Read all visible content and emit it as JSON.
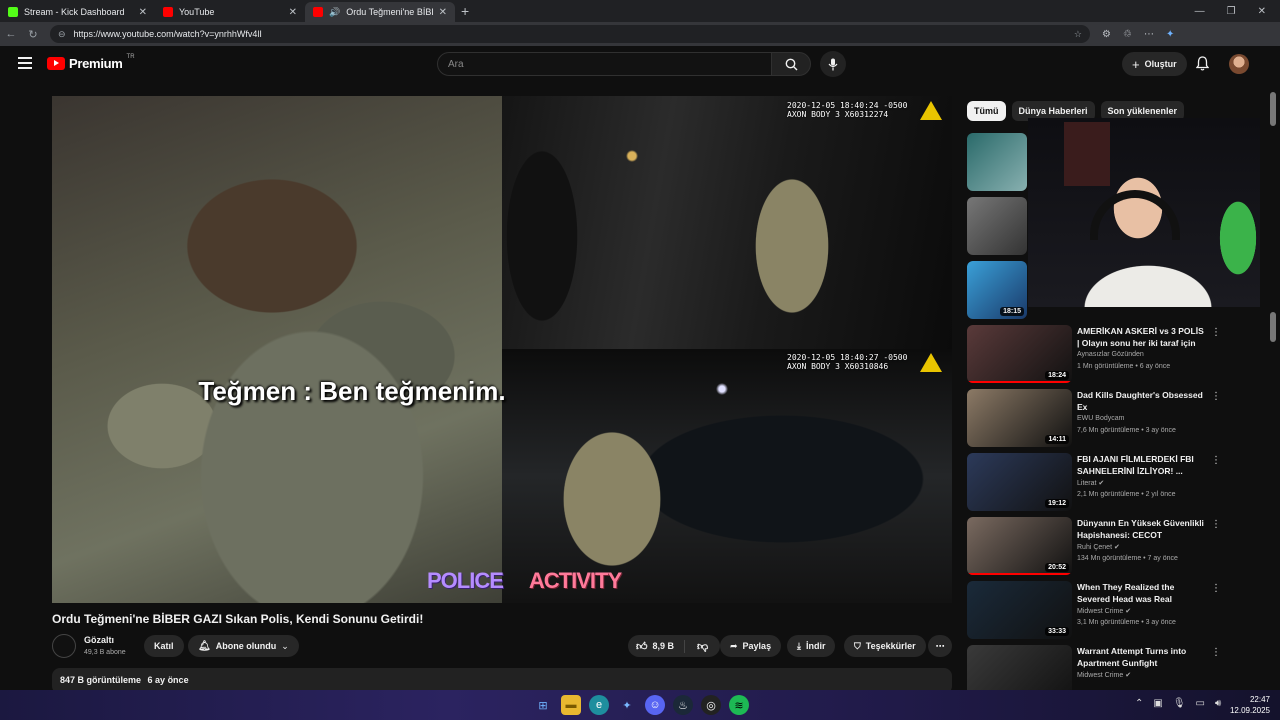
{
  "browser": {
    "tabs": [
      {
        "label": "Stream - Kick Dashboard",
        "favicon_color": "#53fc18"
      },
      {
        "label": "YouTube",
        "favicon_color": "#ff0000"
      },
      {
        "label": "Ordu Teğmeni'ne BİBER GAZI",
        "favicon_color": "#ff0000"
      }
    ],
    "url": "https://www.youtube.com/watch?v=ynrhhWfv4lI"
  },
  "header": {
    "logo_text": "Premium",
    "logo_region": "TR",
    "search_placeholder": "Ara",
    "create_label": "Oluştur"
  },
  "player": {
    "stamp_top": "2020-12-05 18:40:24 -0500\nAXON BODY 3 X60312274",
    "stamp_bottom": "2020-12-05 18:40:27 -0500\nAXON BODY 3 X60310846",
    "subtitle": "Teğmen : Ben teğmenim.",
    "watermark_left": "POLICE",
    "watermark_right": "ACTIVITY"
  },
  "video": {
    "title": "Ordu Teğmeni'ne BİBER GAZI Sıkan Polis, Kendi Sonunu Getirdi!",
    "channel": "Gözaltı",
    "subscribers": "49,3 B abone",
    "join_label": "Katıl",
    "subscribed_label": "Abone olundu",
    "likes": "8,9 B",
    "share_label": "Paylaş",
    "download_label": "İndir",
    "thanks_label": "Teşekkürler",
    "views": "847 B görüntüleme",
    "age": "6 ay önce"
  },
  "sidebar": {
    "chips": [
      "Tümü",
      "Dünya Haberleri",
      "Son yüklenenler"
    ],
    "partial_durations": [
      "18:15"
    ],
    "recs": [
      {
        "title": "AMERİKAN ASKERİ vs 3 POLİS | Olayın sonu her iki taraf için d...",
        "channel": "Aynasızlar Gözünden",
        "meta": "1 Mn görüntüleme • 6 ay önce",
        "duration": "18:24",
        "verified": false,
        "thumb": "#5a3a3a",
        "watched": 1.0
      },
      {
        "title": "Dad Kills Daughter's Obsessed Ex",
        "channel": "EWU Bodycam",
        "meta": "7,6 Mn görüntüleme • 3 ay önce",
        "duration": "14:11",
        "verified": false,
        "thumb": "#8c7a66",
        "watched": 0
      },
      {
        "title": "FBI AJANI FİLMLERDEKİ FBI SAHNELERİNİ İZLİYOR! ...",
        "channel": "Literat",
        "meta": "2,1 Mn görüntüleme • 2 yıl önce",
        "duration": "19:12",
        "verified": true,
        "thumb": "#2c3a5a",
        "watched": 0
      },
      {
        "title": "Dünyanın En Yüksek Güvenlikli Hapishanesi: CECOT (Şeytanla...",
        "channel": "Ruhi Çenet",
        "meta": "134 Mn görüntüleme • 7 ay önce",
        "duration": "20:52",
        "verified": true,
        "thumb": "#7a6a60",
        "watched": 1.0
      },
      {
        "title": "When They Realized the Severed Head was Real",
        "channel": "Midwest Crime",
        "meta": "3,1 Mn görüntüleme • 3 ay önce",
        "duration": "33:33",
        "verified": true,
        "thumb": "#1a2a3a",
        "watched": 0
      },
      {
        "title": "Warrant Attempt Turns into Apartment Gunfight",
        "channel": "Midwest Crime",
        "meta": "",
        "duration": "",
        "verified": true,
        "thumb": "#3a3a3a",
        "watched": 0
      }
    ]
  },
  "taskbar": {
    "time": "22:47",
    "date": "12.09.2025"
  }
}
